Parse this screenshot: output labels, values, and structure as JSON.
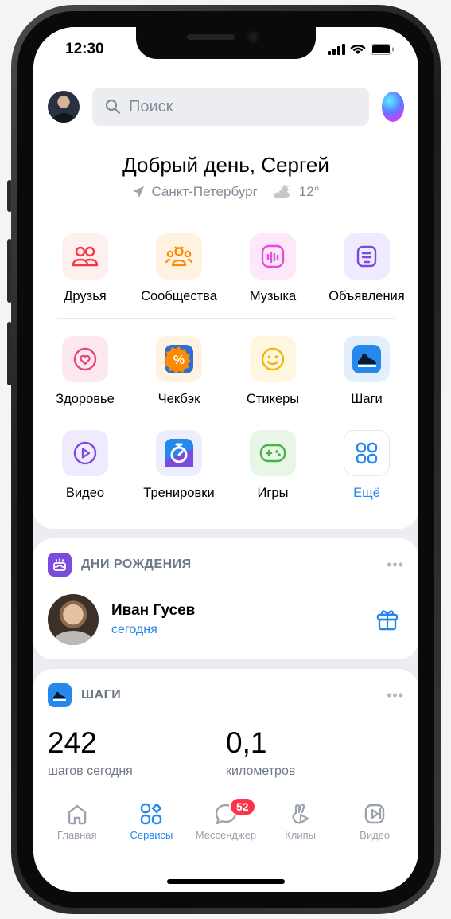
{
  "status": {
    "time": "12:30"
  },
  "search": {
    "placeholder": "Поиск"
  },
  "greeting": {
    "title": "Добрый день, Сергей",
    "city": "Санкт-Петербург",
    "temperature": "12°"
  },
  "services_row1": [
    {
      "label": "Друзья",
      "icon": "friends-icon",
      "color": "#ff3347"
    },
    {
      "label": "Сообщества",
      "icon": "communities-icon",
      "color": "#ff8a00"
    },
    {
      "label": "Музыка",
      "icon": "music-icon",
      "color": "#e64bdc"
    },
    {
      "label": "Объявления",
      "icon": "ads-icon",
      "color": "#7a4bdf"
    }
  ],
  "services_row2": [
    {
      "label": "Здоровье",
      "icon": "health-icon",
      "color": "#e6457a"
    },
    {
      "label": "Чекбэк",
      "icon": "cashback-icon",
      "color": "#ff7a00"
    },
    {
      "label": "Стикеры",
      "icon": "stickers-icon",
      "color": "#f2b705"
    },
    {
      "label": "Шаги",
      "icon": "steps-icon",
      "color": "#2688eb"
    }
  ],
  "services_row3": [
    {
      "label": "Видео",
      "icon": "video-icon",
      "color": "#7a4bdf"
    },
    {
      "label": "Тренировки",
      "icon": "workouts-icon",
      "color": "#5b6cff"
    },
    {
      "label": "Игры",
      "icon": "games-icon",
      "color": "#4bb34b"
    },
    {
      "label": "Ещё",
      "icon": "more-icon",
      "color": "#2688eb"
    }
  ],
  "birthdays": {
    "title": "ДНИ РОЖДЕНИЯ",
    "name": "Иван Гусев",
    "when": "сегодня"
  },
  "steps": {
    "title": "ШАГИ",
    "count": "242",
    "count_label": "шагов сегодня",
    "distance": "0,1",
    "distance_label": "километров"
  },
  "tabbar": {
    "home": "Главная",
    "services": "Сервисы",
    "messenger": "Мессенджер",
    "messenger_badge": "52",
    "clips": "Клипы",
    "video": "Видео"
  }
}
